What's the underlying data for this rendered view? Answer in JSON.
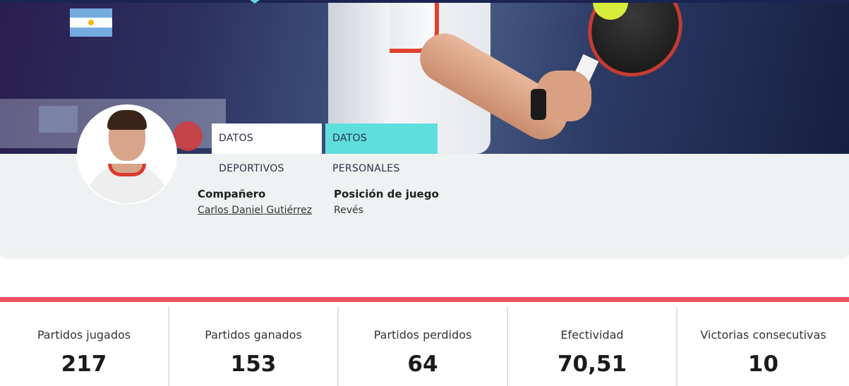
{
  "profile": {
    "tabs": [
      "DATOS DEPORTIVOS",
      "DATOS PERSONALES"
    ],
    "fields": [
      {
        "label": "Compañero",
        "value": "Carlos Daniel Gutiérrez"
      },
      {
        "label": "Posición de juego",
        "value": "Revés"
      }
    ]
  },
  "stats": [
    {
      "label": "Partidos jugados",
      "value": "217"
    },
    {
      "label": "Partidos ganados",
      "value": "153"
    },
    {
      "label": "Partidos perdidos",
      "value": "64"
    },
    {
      "label": "Efectividad",
      "value": "70,51"
    },
    {
      "label": "Victorias consecutivas",
      "value": "10"
    }
  ],
  "colors": {
    "accent": "#5fdede",
    "stats_bar": "#ef4f5e",
    "panel_bg": "#eef2f2"
  },
  "icons": {
    "flag": "argentina-flag-icon"
  }
}
